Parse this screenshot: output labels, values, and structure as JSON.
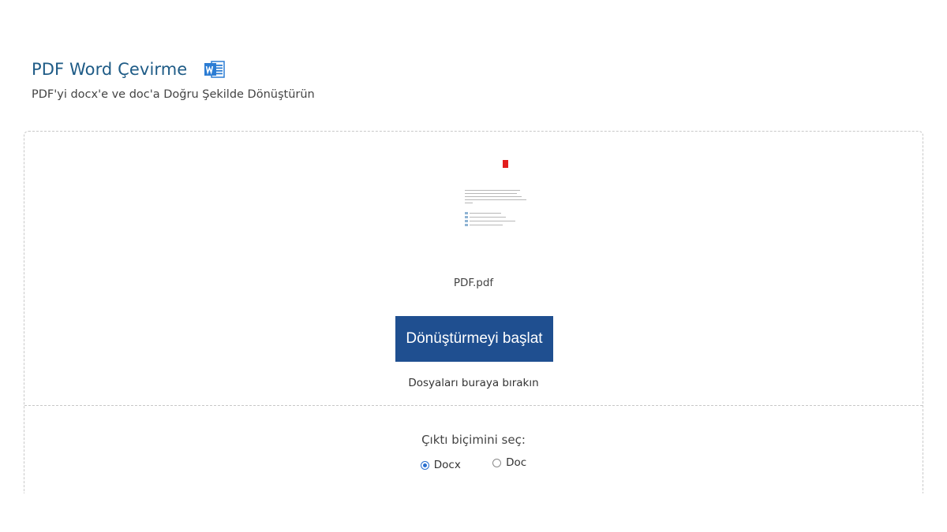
{
  "header": {
    "title": "PDF Word Çevirme",
    "subtitle": "PDF'yi docx'e ve doc'a Doğru Şekilde Dönüştürün",
    "icon": "microsoft-word-icon",
    "icon_color": "#2b7cd3"
  },
  "dropzone": {
    "file_name": "PDF.pdf",
    "file_thumbnail_icon": "pdf-page-thumbnail",
    "start_button_label": "Dönüştürmeyi başlat",
    "drop_hint": "Dosyaları buraya bırakın",
    "button_color": "#1f4f90"
  },
  "output_format": {
    "label": "Çıktı biçimini seç:",
    "options": [
      {
        "label": "Docx",
        "selected": true
      },
      {
        "label": "Doc",
        "selected": false
      }
    ]
  },
  "colors": {
    "title": "#1e5b86",
    "accent": "#2a6fcf"
  }
}
